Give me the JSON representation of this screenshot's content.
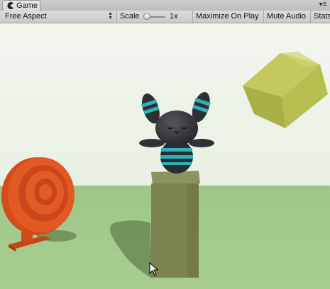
{
  "window": {
    "tab_title": "Game",
    "tab_icon": "pacman-icon",
    "menu_icon": "pane-menu-icon"
  },
  "toolbar": {
    "aspect_label": "Free Aspect",
    "scale_label": "Scale",
    "scale_value": "1x",
    "maximize_label": "Maximize On Play",
    "mute_label": "Mute Audio",
    "stats_label": "Stats"
  },
  "scene": {
    "sky_color": "#edf3e9",
    "ground_color": "#a4c98c",
    "target_color": "#e0531f",
    "cube_color": "#b5bd4e",
    "pillar_color": "#7f8552",
    "bunny_color": "#2e2f33",
    "bunny_stripe_color": "#2bb3ba"
  }
}
